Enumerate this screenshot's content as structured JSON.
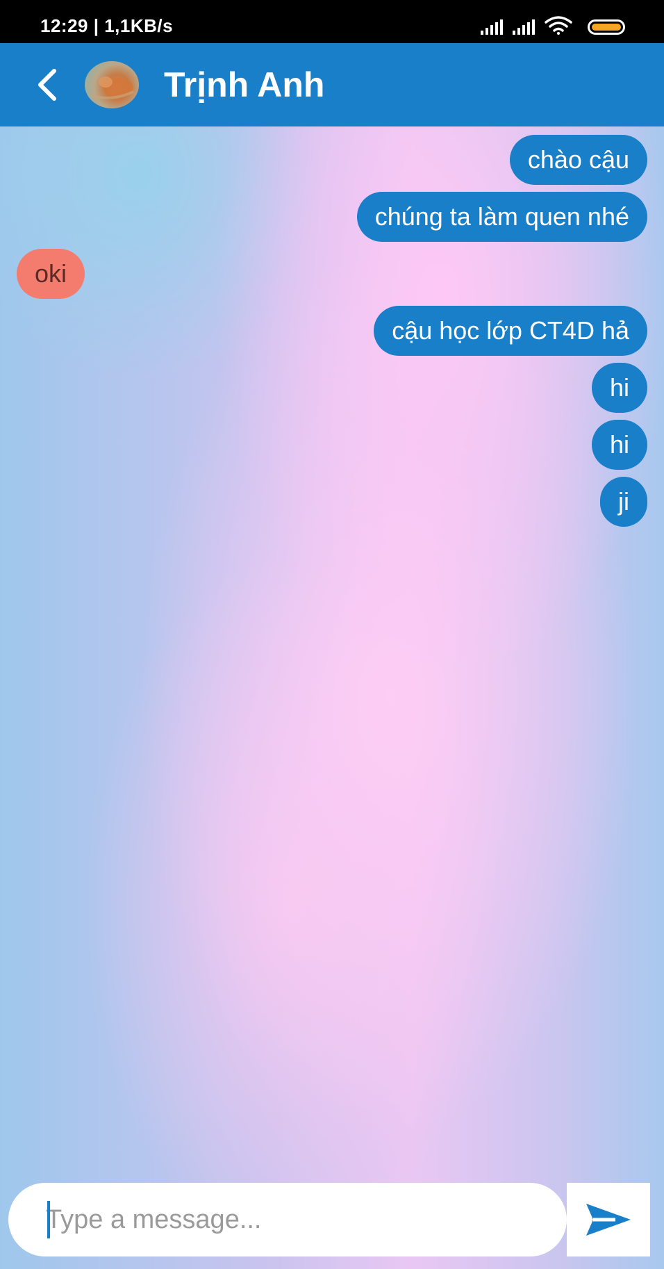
{
  "status_bar": {
    "text": "12:29 | 1,1KB/s",
    "battery_color": "#f6a623"
  },
  "header": {
    "title": "Trịnh Anh",
    "background_color": "#1a7fc9",
    "back_icon": "chevron-left-icon",
    "avatar": "contact-avatar"
  },
  "messages": [
    {
      "text": "chào cậu",
      "direction": "sent"
    },
    {
      "text": "chúng ta làm quen nhé",
      "direction": "sent"
    },
    {
      "text": "oki",
      "direction": "received"
    },
    {
      "text": "cậu học lớp CT4D hả",
      "direction": "sent"
    },
    {
      "text": "hi",
      "direction": "sent"
    },
    {
      "text": "hi",
      "direction": "sent"
    },
    {
      "text": "ji",
      "direction": "sent"
    }
  ],
  "colors": {
    "sent_bubble": "#1a7fc9",
    "received_bubble": "#f47c6e"
  },
  "composer": {
    "placeholder": "Type a message...",
    "value": "",
    "send_icon": "send-icon"
  }
}
